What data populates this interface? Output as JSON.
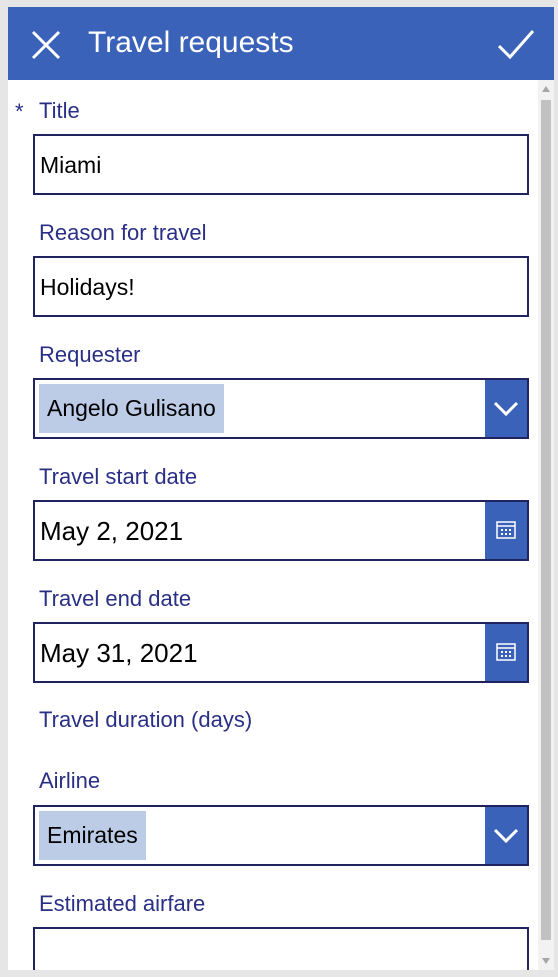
{
  "header": {
    "title": "Travel requests",
    "close_icon": "close-icon",
    "submit_icon": "checkmark-icon"
  },
  "form": {
    "required_marker": "*",
    "title": {
      "label": "Title",
      "value": "Miami"
    },
    "reason": {
      "label": "Reason for travel",
      "value": "Holidays!"
    },
    "requester": {
      "label": "Requester",
      "value": "Angelo Gulisano"
    },
    "start_date": {
      "label": "Travel start date",
      "value": "May 2, 2021"
    },
    "end_date": {
      "label": "Travel end date",
      "value": "May 31, 2021"
    },
    "duration": {
      "label": "Travel duration (days)"
    },
    "airline": {
      "label": "Airline",
      "value": "Emirates"
    },
    "airfare": {
      "label": "Estimated airfare",
      "value": ""
    }
  },
  "colors": {
    "accent": "#3a62b8",
    "label": "#2a2f86",
    "chip": "#bccbe6",
    "border": "#1f2460"
  }
}
